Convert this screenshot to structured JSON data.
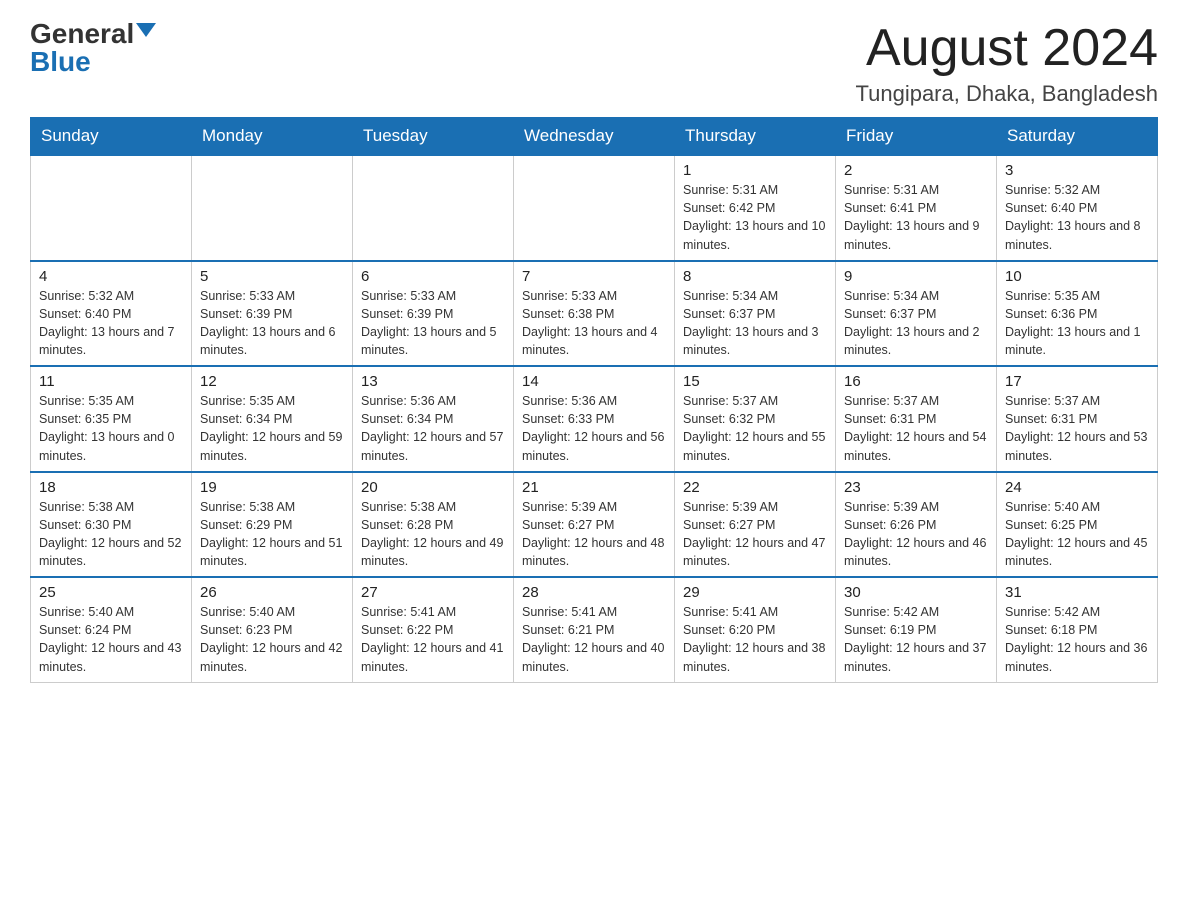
{
  "header": {
    "logo_general": "General",
    "logo_blue": "Blue",
    "month_title": "August 2024",
    "location": "Tungipara, Dhaka, Bangladesh"
  },
  "weekdays": [
    "Sunday",
    "Monday",
    "Tuesday",
    "Wednesday",
    "Thursday",
    "Friday",
    "Saturday"
  ],
  "weeks": [
    [
      {
        "day": "",
        "info": ""
      },
      {
        "day": "",
        "info": ""
      },
      {
        "day": "",
        "info": ""
      },
      {
        "day": "",
        "info": ""
      },
      {
        "day": "1",
        "info": "Sunrise: 5:31 AM\nSunset: 6:42 PM\nDaylight: 13 hours and 10 minutes."
      },
      {
        "day": "2",
        "info": "Sunrise: 5:31 AM\nSunset: 6:41 PM\nDaylight: 13 hours and 9 minutes."
      },
      {
        "day": "3",
        "info": "Sunrise: 5:32 AM\nSunset: 6:40 PM\nDaylight: 13 hours and 8 minutes."
      }
    ],
    [
      {
        "day": "4",
        "info": "Sunrise: 5:32 AM\nSunset: 6:40 PM\nDaylight: 13 hours and 7 minutes."
      },
      {
        "day": "5",
        "info": "Sunrise: 5:33 AM\nSunset: 6:39 PM\nDaylight: 13 hours and 6 minutes."
      },
      {
        "day": "6",
        "info": "Sunrise: 5:33 AM\nSunset: 6:39 PM\nDaylight: 13 hours and 5 minutes."
      },
      {
        "day": "7",
        "info": "Sunrise: 5:33 AM\nSunset: 6:38 PM\nDaylight: 13 hours and 4 minutes."
      },
      {
        "day": "8",
        "info": "Sunrise: 5:34 AM\nSunset: 6:37 PM\nDaylight: 13 hours and 3 minutes."
      },
      {
        "day": "9",
        "info": "Sunrise: 5:34 AM\nSunset: 6:37 PM\nDaylight: 13 hours and 2 minutes."
      },
      {
        "day": "10",
        "info": "Sunrise: 5:35 AM\nSunset: 6:36 PM\nDaylight: 13 hours and 1 minute."
      }
    ],
    [
      {
        "day": "11",
        "info": "Sunrise: 5:35 AM\nSunset: 6:35 PM\nDaylight: 13 hours and 0 minutes."
      },
      {
        "day": "12",
        "info": "Sunrise: 5:35 AM\nSunset: 6:34 PM\nDaylight: 12 hours and 59 minutes."
      },
      {
        "day": "13",
        "info": "Sunrise: 5:36 AM\nSunset: 6:34 PM\nDaylight: 12 hours and 57 minutes."
      },
      {
        "day": "14",
        "info": "Sunrise: 5:36 AM\nSunset: 6:33 PM\nDaylight: 12 hours and 56 minutes."
      },
      {
        "day": "15",
        "info": "Sunrise: 5:37 AM\nSunset: 6:32 PM\nDaylight: 12 hours and 55 minutes."
      },
      {
        "day": "16",
        "info": "Sunrise: 5:37 AM\nSunset: 6:31 PM\nDaylight: 12 hours and 54 minutes."
      },
      {
        "day": "17",
        "info": "Sunrise: 5:37 AM\nSunset: 6:31 PM\nDaylight: 12 hours and 53 minutes."
      }
    ],
    [
      {
        "day": "18",
        "info": "Sunrise: 5:38 AM\nSunset: 6:30 PM\nDaylight: 12 hours and 52 minutes."
      },
      {
        "day": "19",
        "info": "Sunrise: 5:38 AM\nSunset: 6:29 PM\nDaylight: 12 hours and 51 minutes."
      },
      {
        "day": "20",
        "info": "Sunrise: 5:38 AM\nSunset: 6:28 PM\nDaylight: 12 hours and 49 minutes."
      },
      {
        "day": "21",
        "info": "Sunrise: 5:39 AM\nSunset: 6:27 PM\nDaylight: 12 hours and 48 minutes."
      },
      {
        "day": "22",
        "info": "Sunrise: 5:39 AM\nSunset: 6:27 PM\nDaylight: 12 hours and 47 minutes."
      },
      {
        "day": "23",
        "info": "Sunrise: 5:39 AM\nSunset: 6:26 PM\nDaylight: 12 hours and 46 minutes."
      },
      {
        "day": "24",
        "info": "Sunrise: 5:40 AM\nSunset: 6:25 PM\nDaylight: 12 hours and 45 minutes."
      }
    ],
    [
      {
        "day": "25",
        "info": "Sunrise: 5:40 AM\nSunset: 6:24 PM\nDaylight: 12 hours and 43 minutes."
      },
      {
        "day": "26",
        "info": "Sunrise: 5:40 AM\nSunset: 6:23 PM\nDaylight: 12 hours and 42 minutes."
      },
      {
        "day": "27",
        "info": "Sunrise: 5:41 AM\nSunset: 6:22 PM\nDaylight: 12 hours and 41 minutes."
      },
      {
        "day": "28",
        "info": "Sunrise: 5:41 AM\nSunset: 6:21 PM\nDaylight: 12 hours and 40 minutes."
      },
      {
        "day": "29",
        "info": "Sunrise: 5:41 AM\nSunset: 6:20 PM\nDaylight: 12 hours and 38 minutes."
      },
      {
        "day": "30",
        "info": "Sunrise: 5:42 AM\nSunset: 6:19 PM\nDaylight: 12 hours and 37 minutes."
      },
      {
        "day": "31",
        "info": "Sunrise: 5:42 AM\nSunset: 6:18 PM\nDaylight: 12 hours and 36 minutes."
      }
    ]
  ]
}
